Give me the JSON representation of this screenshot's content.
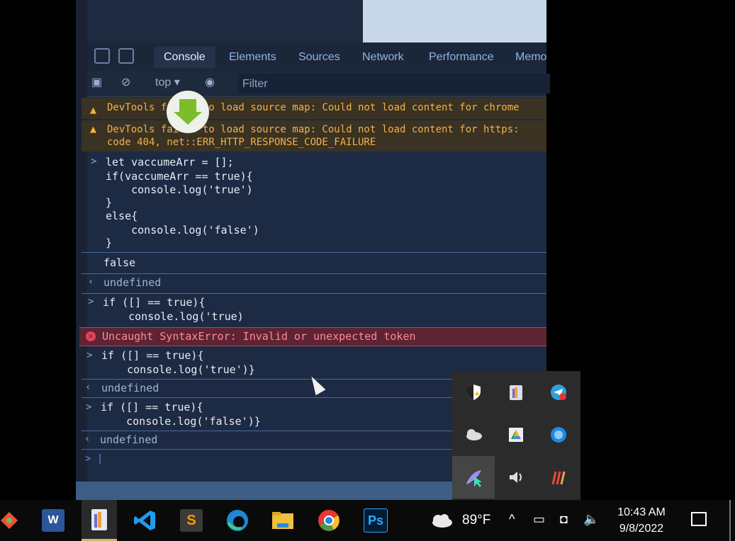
{
  "devtools": {
    "tabs": [
      "Console",
      "Elements",
      "Sources",
      "Network",
      "Performance",
      "Memo"
    ],
    "context": "top ▾",
    "filter_placeholder": "Filter",
    "warnings": [
      {
        "line1": "DevTools failed to load source map: Could not load content for chrome"
      },
      {
        "line1": "DevTools failed to load source map: Could not load content for https:",
        "line2": "code 404, net::ERR_HTTP_RESPONSE_CODE_FAILURE"
      }
    ],
    "block1": [
      "let vaccumeArr = [];",
      "if(vaccumeArr == true){",
      "    console.log('true')",
      "}",
      "else{",
      "    console.log('false')",
      "}"
    ],
    "output_false": "false",
    "undefined_text": "undefined",
    "block2": [
      "if ([] == true){",
      "    console.log('true)"
    ],
    "error_text": "Uncaught SyntaxError: Invalid or unexpected token",
    "block3": [
      "if ([] == true){",
      "    console.log('true')}"
    ],
    "block4": [
      "if ([] == true){",
      "    console.log('false')}"
    ]
  },
  "taskbar": {
    "apps": [
      "git-app",
      "Word",
      "Paint3D",
      "VS Code",
      "Sublime Text",
      "Edge",
      "File Explorer",
      "Chrome",
      "Photoshop"
    ],
    "temperature": "89°F",
    "time": "10:43 AM",
    "date": "9/8/2022"
  },
  "tray_icons": [
    "windows-security-icon",
    "paint-icon",
    "telegram-icon",
    "onedrive-icon",
    "google-drive-icon",
    "app-icon",
    "feather-app-icon",
    "speaker-device-icon",
    "app-striped-icon"
  ]
}
